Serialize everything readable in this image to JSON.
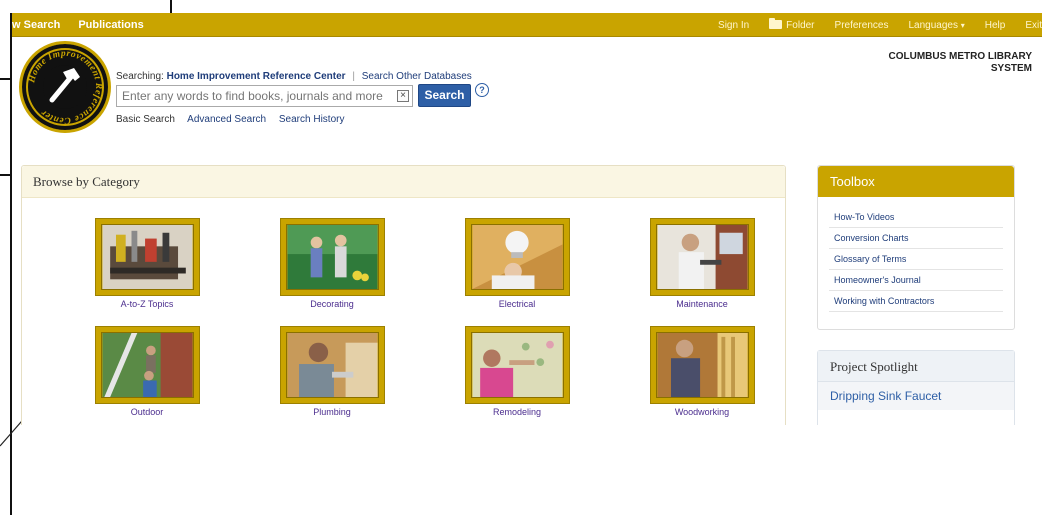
{
  "topbar": {
    "left": [
      "w Search",
      "Publications"
    ],
    "right": {
      "sign_in": "Sign In",
      "folder": "Folder",
      "preferences": "Preferences",
      "languages": "Languages",
      "languages_caret": "▾",
      "help": "Help",
      "exit": "Exit"
    }
  },
  "logo": {
    "ring_text": "Home Improvement Reference Center",
    "icon": "hammer-icon"
  },
  "library": {
    "line1": "COLUMBUS METRO LIBRARY",
    "line2": "SYSTEM"
  },
  "search": {
    "searching_label": "Searching:",
    "database": "Home Improvement Reference Center",
    "separator": "|",
    "other": "Search Other Databases",
    "placeholder": "Enter any words to find books, journals and more",
    "clear_glyph": "×",
    "button": "Search",
    "help_glyph": "?",
    "links": {
      "basic": "Basic Search",
      "advanced": "Advanced Search",
      "history": "Search History"
    }
  },
  "browse": {
    "title": "Browse by Category",
    "categories": [
      {
        "label": "A-to-Z Topics"
      },
      {
        "label": "Decorating"
      },
      {
        "label": "Electrical"
      },
      {
        "label": "Maintenance"
      },
      {
        "label": "Outdoor"
      },
      {
        "label": "Plumbing"
      },
      {
        "label": "Remodeling"
      },
      {
        "label": "Woodworking"
      }
    ]
  },
  "toolbox": {
    "title": "Toolbox",
    "items": [
      "How-To Videos",
      "Conversion Charts",
      "Glossary of Terms",
      "Homeowner's Journal",
      "Working with Contractors"
    ]
  },
  "spotlight": {
    "title": "Project Spotlight",
    "link": "Dripping Sink Faucet"
  },
  "colors": {
    "accent": "#c9a400",
    "link": "#1f3d7a",
    "category_link": "#4b2d8e",
    "button": "#2e5fa6"
  }
}
